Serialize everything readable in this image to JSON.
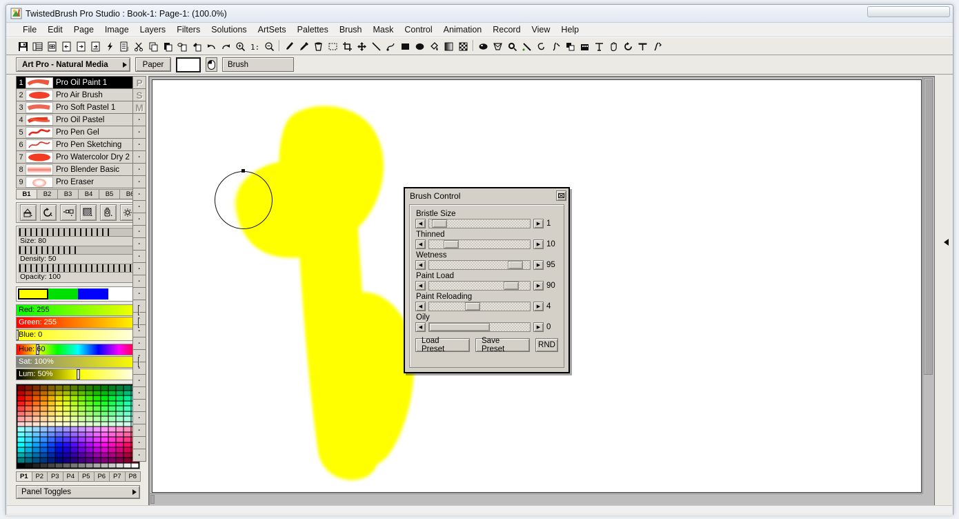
{
  "window": {
    "title": "TwistedBrush Pro Studio : Book-1: Page-1:  (100.0%)",
    "app_icon": "twistedbrush-icon"
  },
  "menubar": {
    "items": [
      "File",
      "Edit",
      "Page",
      "Image",
      "Layers",
      "Filters",
      "Solutions",
      "ArtSets",
      "Palettes",
      "Brush",
      "Mask",
      "Control",
      "Animation",
      "Record",
      "View",
      "Help"
    ]
  },
  "toolbar": {
    "groups": [
      [
        "save-icon",
        "book-icon",
        "page-add-icon",
        "page-prev-icon",
        "page-next-icon",
        "page-copy-icon",
        "flash-icon",
        "page-list-icon",
        "cut-icon",
        "copy-icon",
        "paste-icon",
        "erase-page-icon",
        "fill-page-icon",
        "undo-icon",
        "redo-icon",
        "zoom-in-icon",
        "zoom-actual-icon",
        "zoom-out-icon"
      ],
      [
        "brush-tool-icon",
        "eyedropper-icon",
        "bucket-tool-icon",
        "select-icon",
        "crop-icon",
        "move-icon",
        "line-icon",
        "curve-icon",
        "rect-icon",
        "ellipse-icon",
        "fill-icon",
        "gradient-icon",
        "checker-icon",
        "sphere-icon",
        "warp-icon",
        "magnify-mask-icon",
        "wand-icon",
        "smudge-icon",
        "scatter-icon",
        "clone-icon",
        "stamp-icon",
        "text-icon",
        "hand-icon",
        "rotate-icon",
        "ruler-icon",
        "effects-icon"
      ]
    ]
  },
  "subbar": {
    "artset_label": "Art Pro - Natural Media",
    "paper_label": "Paper",
    "paper_color": "#ffffff",
    "mouse_icon": "mouse-icon",
    "brush_label": "Brush"
  },
  "brush_list": {
    "items": [
      {
        "num": "1",
        "name": "Pro Oil Paint 1",
        "selected": true,
        "thumb": "stroke-oil-paint"
      },
      {
        "num": "2",
        "name": "Pro Air Brush",
        "selected": false,
        "thumb": "stroke-air-brush"
      },
      {
        "num": "3",
        "name": "Pro Soft Pastel 1",
        "selected": false,
        "thumb": "stroke-soft-pastel"
      },
      {
        "num": "4",
        "name": "Pro Oil Pastel",
        "selected": false,
        "thumb": "stroke-oil-pastel"
      },
      {
        "num": "5",
        "name": "Pro Pen Gel",
        "selected": false,
        "thumb": "stroke-pen-gel"
      },
      {
        "num": "6",
        "name": "Pro Pen Sketching",
        "selected": false,
        "thumb": "stroke-pen-sketch"
      },
      {
        "num": "7",
        "name": "Pro Watercolor Dry 2",
        "selected": false,
        "thumb": "stroke-watercolor"
      },
      {
        "num": "8",
        "name": "Pro Blender Basic",
        "selected": false,
        "thumb": "stroke-blender"
      },
      {
        "num": "9",
        "name": "Pro Eraser",
        "selected": false,
        "thumb": "stroke-eraser"
      }
    ],
    "tabs": [
      "B1",
      "B2",
      "B3",
      "B4",
      "B5",
      "B6"
    ],
    "active_tab": "B1",
    "side_strip": [
      "P",
      "S",
      "M",
      "·",
      "·",
      "·",
      "·",
      "·",
      "·",
      "·",
      "·",
      "·",
      "·",
      "·",
      "·",
      "·",
      "·",
      "·",
      "·",
      "·",
      "·",
      "·",
      "·",
      "·",
      "·",
      "·",
      "·",
      "·",
      "·",
      "·",
      "·"
    ]
  },
  "brush_tools": {
    "icons": [
      "shape-tool-icon",
      "rotate-tool-icon",
      "size-tool-icon",
      "texture-tool-icon",
      "spray-tool-icon",
      "settings-gear-icon"
    ]
  },
  "brush_sliders": [
    {
      "label": "Size: 80",
      "name": "size",
      "value": 80,
      "max": 100
    },
    {
      "label": "Density: 50",
      "name": "density",
      "value": 50,
      "max": 100
    },
    {
      "label": "Opacity: 100",
      "name": "opacity",
      "value": 100,
      "max": 100
    }
  ],
  "color": {
    "swatches": [
      {
        "hex": "#ffff00",
        "active": true
      },
      {
        "hex": "#00e000",
        "active": false
      },
      {
        "hex": "#0000ff",
        "active": false
      },
      {
        "hex": "#ffffff",
        "active": false
      }
    ],
    "rgb": [
      {
        "label": "Red: 255",
        "name": "red",
        "value": 255,
        "pct": 100,
        "grad": "linear-gradient(90deg,#00ff00,#ffff00)",
        "text": "#000000"
      },
      {
        "label": "Green: 255",
        "name": "green",
        "value": 255,
        "pct": 100,
        "grad": "linear-gradient(90deg,#ff0000,#ff8000,#ffff00)",
        "text": "#ffffff"
      },
      {
        "label": "Blue: 0",
        "name": "blue",
        "value": 0,
        "pct": 0,
        "grad": "linear-gradient(90deg,#ffff00,#ffffe8)",
        "text": "#000000"
      }
    ],
    "hsl": [
      {
        "label": "Hue: 60",
        "name": "hue",
        "value": 60,
        "pct": 17,
        "grad": "linear-gradient(90deg,#ff0000,#ffff00,#00ff00,#00ffff,#0000ff,#ff00ff,#ff0000)",
        "text": "#000000"
      },
      {
        "label": "Sat: 100%",
        "name": "sat",
        "value": 100,
        "pct": 100,
        "grad": "linear-gradient(90deg,#808080,#ffff00)",
        "text": "#ffffff"
      },
      {
        "label": "Lum: 50%",
        "name": "lum",
        "value": 50,
        "pct": 50,
        "grad": "linear-gradient(90deg,#000000,#ffff00,#ffffff)",
        "text": "#ffffff"
      }
    ],
    "palette_tabs": [
      "P1",
      "P2",
      "P3",
      "P4",
      "P5",
      "P6",
      "P7",
      "P8"
    ],
    "palette_active": "P1"
  },
  "panel_toggles": {
    "label": "Panel Toggles"
  },
  "brush_control": {
    "title": "Brush Control",
    "close_icon": "close-icon",
    "controls": [
      {
        "label": "Bristle Size",
        "name": "bristle-size",
        "value": "1",
        "pct": 3
      },
      {
        "label": "Thinned",
        "name": "thinned",
        "value": "10",
        "pct": 17
      },
      {
        "label": "Wetness",
        "name": "wetness",
        "value": "95",
        "pct": 92
      },
      {
        "label": "Paint Load",
        "name": "paint-load",
        "value": "90",
        "pct": 87
      },
      {
        "label": "Paint Reloading",
        "name": "paint-reloading",
        "value": "4",
        "pct": 42
      },
      {
        "label": "Oily",
        "name": "oily",
        "value": "0",
        "pct": 0
      }
    ],
    "buttons": {
      "load_preset": "Load Preset",
      "save_preset": "Save Preset",
      "random": "RND"
    }
  },
  "canvas": {
    "background": "#ffffff",
    "stroke_color": "#ffff00",
    "brush_cursor": "brush-cursor-circle"
  }
}
